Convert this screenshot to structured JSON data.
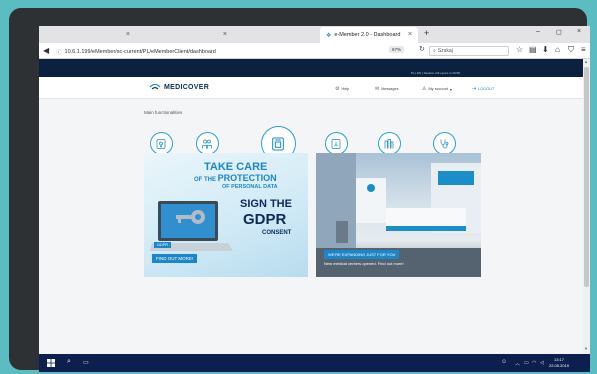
{
  "browser": {
    "tabs": [
      {
        "title": "",
        "active": false
      },
      {
        "title": "",
        "active": false
      },
      {
        "title": "",
        "active": false
      },
      {
        "title": "e-Member 2.0 - Dashboard",
        "active": true
      }
    ],
    "url": "10.6.1.199/eMember/sc-current/PL/eMemberClient/dashboard",
    "zoom": "67%",
    "search_placeholder": "Szukaj",
    "window_controls": [
      "–",
      "◻",
      "×"
    ]
  },
  "page": {
    "top_info": "PL  |  EN  |  Session will expire in 29:58",
    "logo_text": "MEDICOVER",
    "nav": {
      "help": "Help",
      "messages": "Messages",
      "my_account": "My account",
      "logout": "LOGOUT"
    },
    "main_title": "Main functionalities",
    "functions": [
      {
        "label": "Add Person",
        "icon": "add-person-icon"
      },
      {
        "label": "Person List",
        "icon": "person-list-icon"
      },
      {
        "label": "Reports",
        "icon": "reports-icon"
      },
      {
        "label": "Invoice List",
        "icon": "invoice-icon"
      },
      {
        "label": "Company Data",
        "icon": "company-icon"
      },
      {
        "label": "Occupational Health",
        "icon": "stethoscope-icon"
      }
    ],
    "new_offer_title": "New Offer",
    "news_title": "Changes and news in our offer",
    "show_all": "show all >",
    "gdpr_banner": {
      "take_care": "TAKE CARE",
      "of_the": "OF THE",
      "protection": "PROTECTION",
      "of_personal_data": "OF PERSONAL DATA",
      "sign_the": "SIGN THE",
      "gdpr": "GDPR",
      "consent": "CONSENT",
      "tag": "GDPR",
      "cta": "FIND OUT MORE!"
    },
    "office_banner": {
      "cta": "WE'RE EXPANDING JUST FOR YOU",
      "caption": "New medical centers opened. Find out more!"
    }
  },
  "taskbar": {
    "time": "13:17",
    "date": "22.05.2019"
  },
  "colors": {
    "background": "#5bbdc1",
    "brand_navy": "#0b2140",
    "accent": "#1a8ec9",
    "taskbar": "#0c1f4f"
  }
}
